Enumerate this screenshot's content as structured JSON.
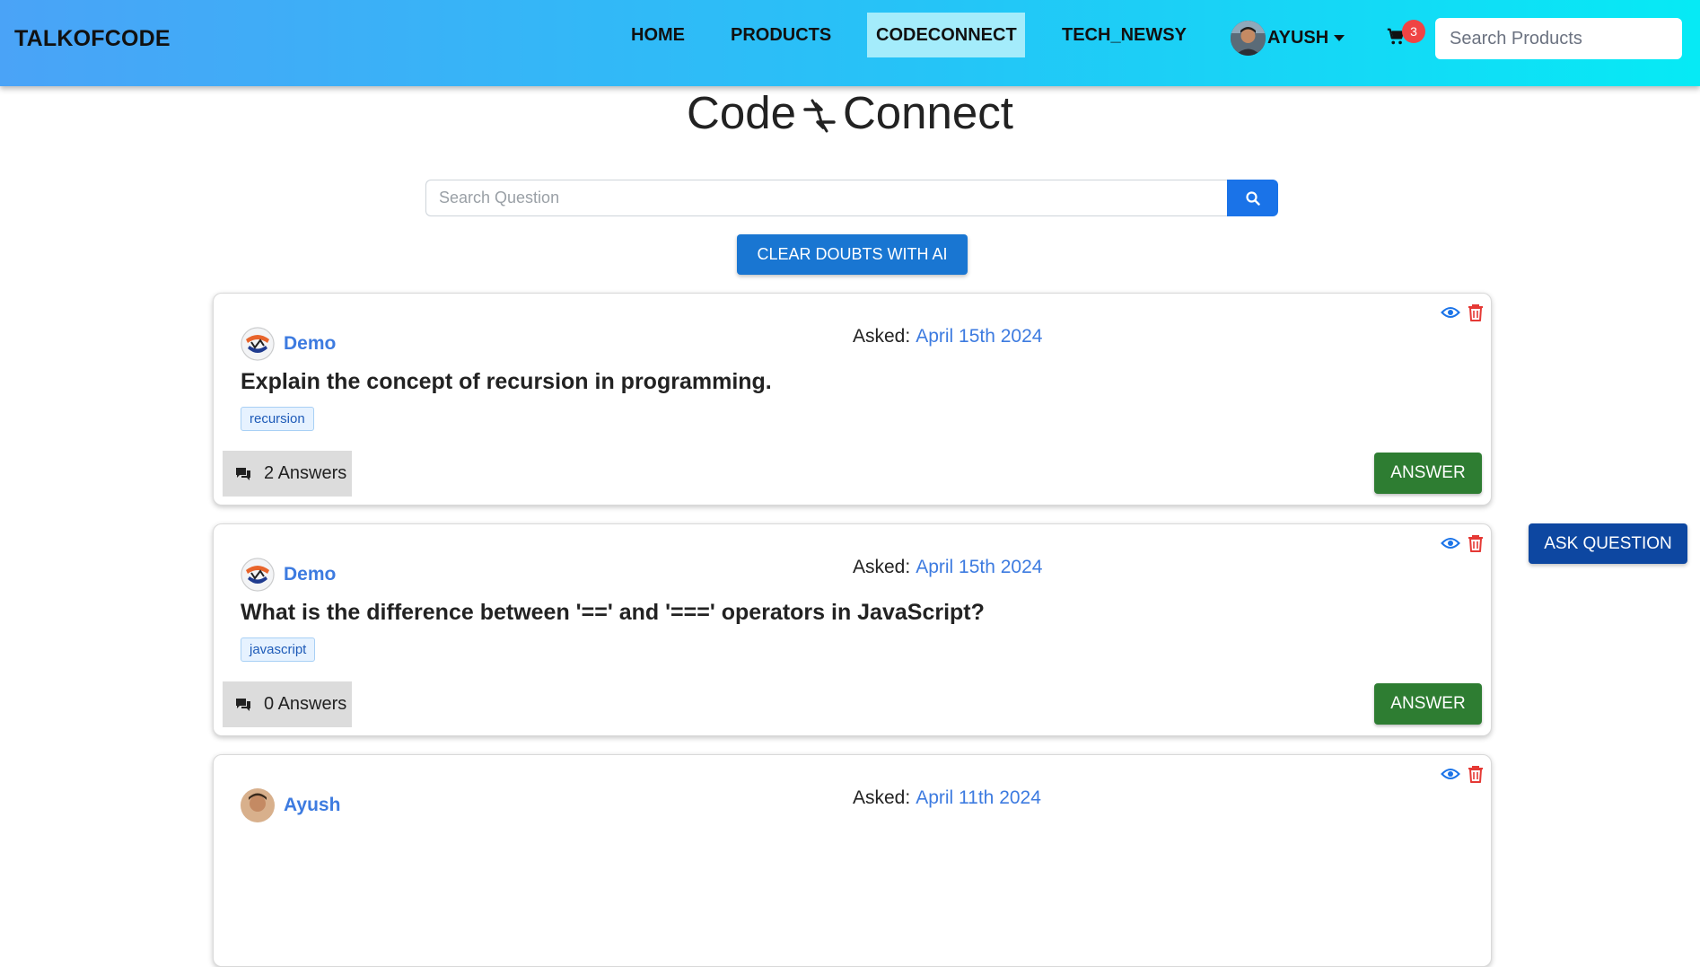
{
  "navbar": {
    "brand": "TALKOFCODE",
    "items": [
      {
        "label": "HOME"
      },
      {
        "label": "PRODUCTS"
      },
      {
        "label": "CODECONNECT"
      },
      {
        "label": "TECH_NEWSY"
      }
    ],
    "active_item": "CODECONNECT",
    "user_name": "AYUSH",
    "cart_count": "3",
    "search_placeholder": "Search Products"
  },
  "header": {
    "title_left": "Code",
    "title_right": "Connect",
    "search_placeholder": "Search Question",
    "ai_button": "CLEAR DOUBTS WITH AI"
  },
  "ask_button": "ASK QUESTION",
  "questions": [
    {
      "user": "Demo",
      "asked_label": "Asked:",
      "date": "April 15th 2024",
      "question": "Explain the concept of recursion in programming.",
      "tag": "recursion",
      "answers": "2 Answers",
      "answer_button": "ANSWER"
    },
    {
      "user": "Demo",
      "asked_label": "Asked:",
      "date": "April 15th 2024",
      "question": "What is the difference between '==' and '===' operators in JavaScript?",
      "tag": "javascript",
      "answers": "0 Answers",
      "answer_button": "ANSWER"
    },
    {
      "user": "Ayush",
      "asked_label": "Asked:",
      "date": "April 11th 2024"
    }
  ],
  "colors": {
    "nav_gradient_start": "#4aa3f7",
    "nav_gradient_end": "#06eaf5",
    "active_nav": "#a4ecfb",
    "link_blue": "#3d7be0",
    "ai_button": "#1976d2",
    "ask_button": "#0d47a1",
    "answer_button": "#2e7d32",
    "badge": "#ef4444",
    "trash": "#e53935"
  }
}
